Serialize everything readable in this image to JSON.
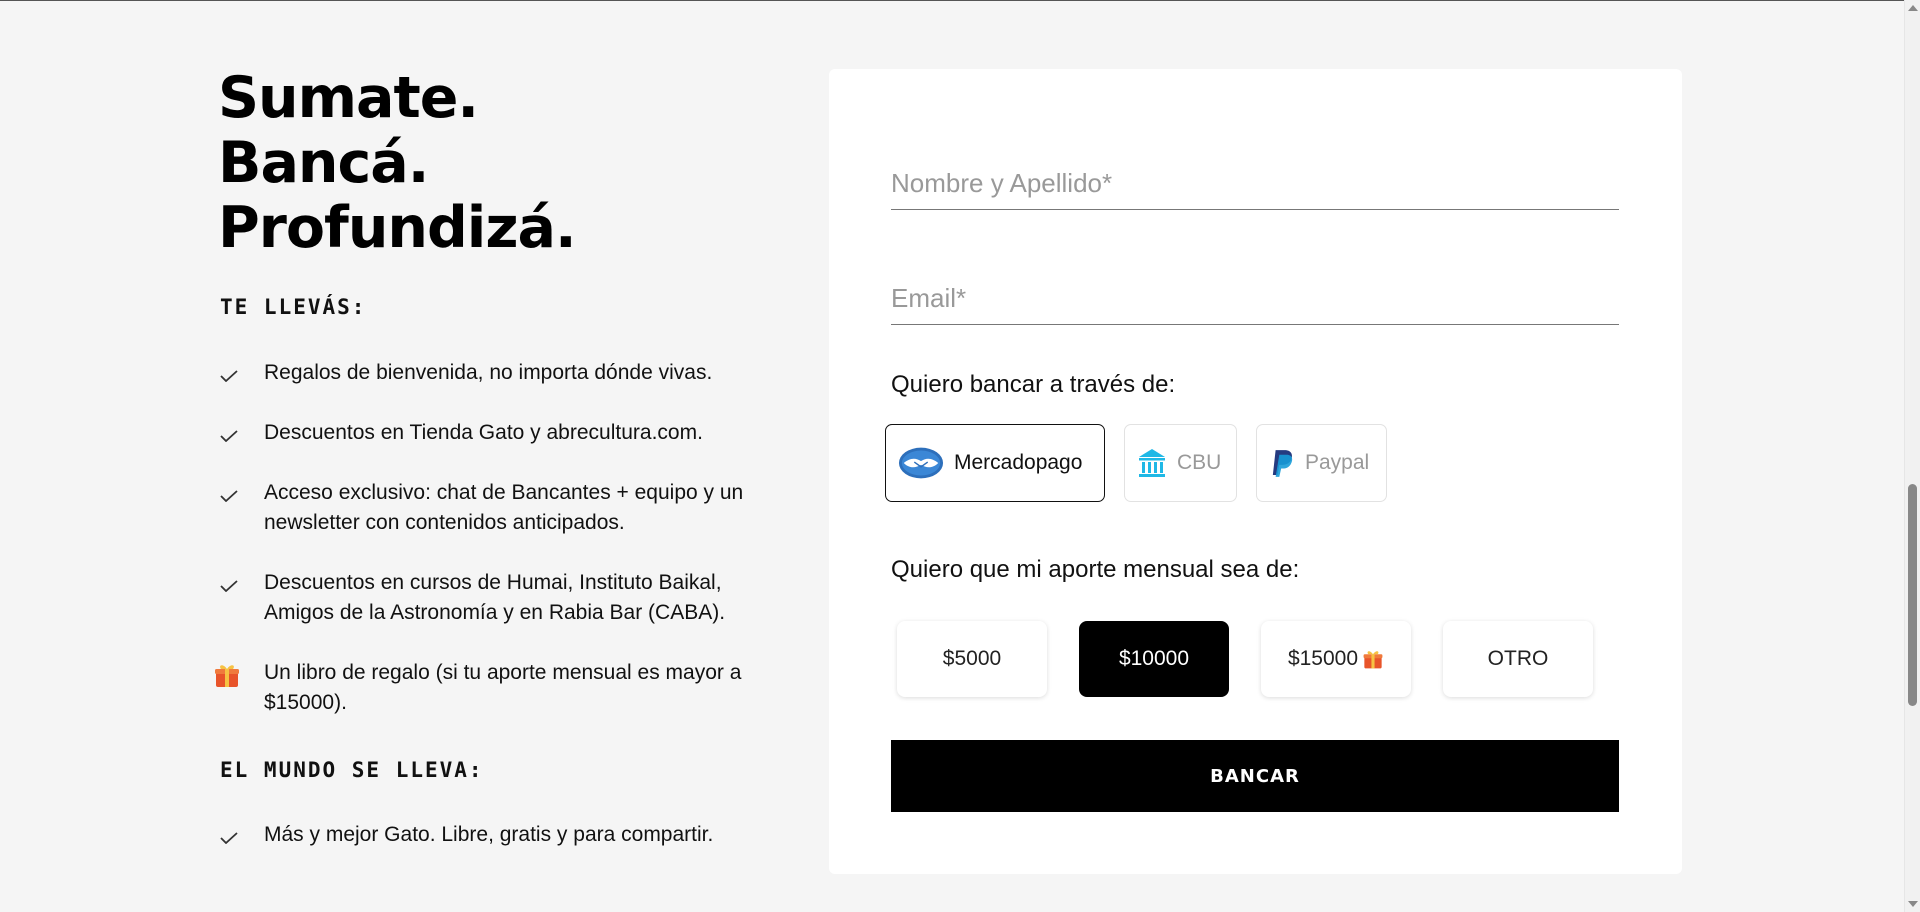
{
  "headline": {
    "line1": "Sumate.",
    "line2": "Bancá.",
    "line3": "Profundizá."
  },
  "you_get": {
    "title": "TE LLEVÁS:",
    "items": [
      {
        "icon": "check-icon",
        "text": "Regalos de bienvenida, no importa dónde vivas."
      },
      {
        "icon": "check-icon",
        "text": "Descuentos en Tienda Gato y abrecultura.com."
      },
      {
        "icon": "check-icon",
        "text": "Acceso exclusivo: chat de Bancantes + equipo y un newsletter con contenidos anticipados."
      },
      {
        "icon": "check-icon",
        "text": "Descuentos en cursos de Humai, Instituto Baikal, Amigos de la Astronomía y en Rabia Bar (CABA)."
      },
      {
        "icon": "gift-icon",
        "text": "Un libro de regalo (si tu aporte mensual es mayor a $15000)."
      }
    ]
  },
  "world_gets": {
    "title": "EL MUNDO SE LLEVA:",
    "items": [
      {
        "icon": "check-icon",
        "text": "Más y mejor Gato. Libre, gratis y para compartir."
      }
    ]
  },
  "form": {
    "name": {
      "value": "",
      "placeholder": "Nombre y Apellido*"
    },
    "email": {
      "value": "",
      "placeholder": "Email*"
    },
    "payment_label": "Quiero bancar a través de:",
    "payment_methods": [
      {
        "label": "Mercadopago",
        "icon": "mercadopago-icon",
        "selected": true
      },
      {
        "label": "CBU",
        "icon": "bank-icon",
        "selected": false
      },
      {
        "label": "Paypal",
        "icon": "paypal-icon",
        "selected": false
      }
    ],
    "amount_label": "Quiero que mi aporte mensual sea de:",
    "amounts": [
      {
        "label": "$5000",
        "selected": false
      },
      {
        "label": "$10000",
        "selected": true
      },
      {
        "label": "$15000",
        "selected": false,
        "icon": "gift-icon"
      },
      {
        "label": "OTRO",
        "selected": false
      }
    ],
    "submit_label": "BANCAR"
  },
  "colors": {
    "accent": "#000000",
    "background": "#f5f5f5",
    "card": "#ffffff",
    "bank_icon": "#1fb8e6",
    "paypal_dark": "#253b80",
    "paypal_light": "#179bd7"
  }
}
